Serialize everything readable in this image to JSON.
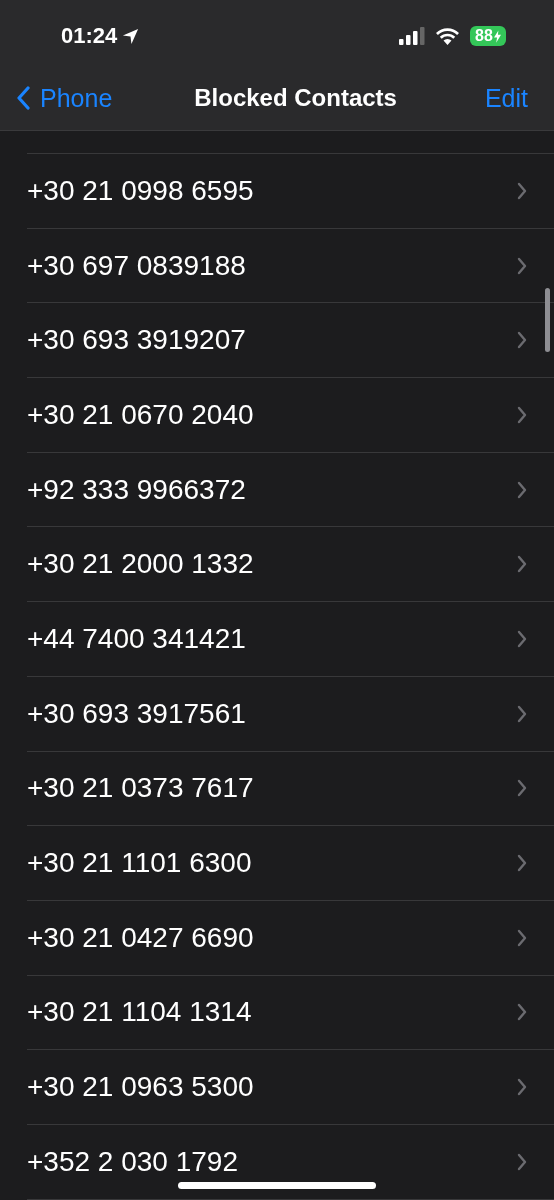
{
  "status_bar": {
    "time": "01:24",
    "battery": "88"
  },
  "nav": {
    "back": "Phone",
    "title": "Blocked Contacts",
    "action": "Edit"
  },
  "contacts": [
    {
      "number": "+30 21 0998 6595"
    },
    {
      "number": "+30 697 0839188"
    },
    {
      "number": "+30 693 3919207"
    },
    {
      "number": "+30 21 0670 2040"
    },
    {
      "number": "+92 333 9966372"
    },
    {
      "number": "+30 21 2000 1332"
    },
    {
      "number": "+44 7400 341421"
    },
    {
      "number": "+30 693 3917561"
    },
    {
      "number": "+30 21 0373 7617"
    },
    {
      "number": "+30 21 1101 6300"
    },
    {
      "number": "+30 21 0427 6690"
    },
    {
      "number": "+30 21 1104 1314"
    },
    {
      "number": "+30 21 0963 5300"
    },
    {
      "number": "+352 2 030 1792"
    }
  ]
}
